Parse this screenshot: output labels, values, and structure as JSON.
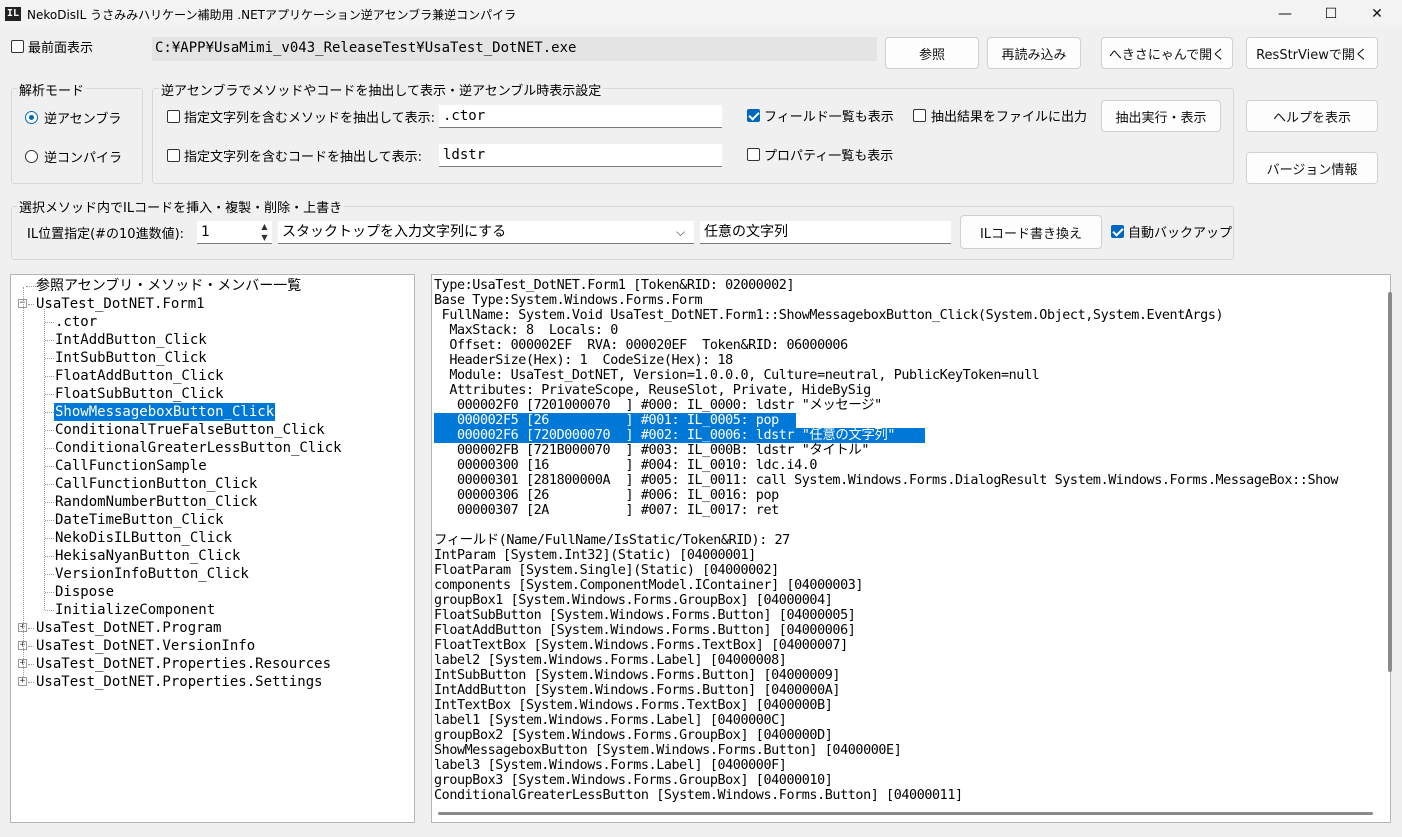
{
  "window": {
    "title": "NekoDisIL うさみみハリケーン補助用 .NETアプリケーション逆アセンブラ兼逆コンパイラ",
    "icon_text": "IL",
    "min_glyph": "—",
    "max_glyph": "☐",
    "close_glyph": "✕"
  },
  "top": {
    "topmost_label": "最前面表示",
    "file_path": "C:¥APP¥UsaMimi_v043_ReleaseTest¥UsaTest_DotNET.exe",
    "browse_label": "参照",
    "reload_label": "再読み込み",
    "open_hekisa_label": "へきさにゃんで開く",
    "open_resstr_label": "ResStrViewで開く"
  },
  "mode": {
    "title": "解析モード",
    "disasm_label": "逆アセンブラ",
    "decompile_label": "逆コンパイラ"
  },
  "extract": {
    "title": "逆アセンブラでメソッドやコードを抽出して表示・逆アセンブル時表示設定",
    "method_filter_label": "指定文字列を含むメソッドを抽出して表示:",
    "method_filter_value": ".ctor",
    "code_filter_label": "指定文字列を含むコードを抽出して表示:",
    "code_filter_value": "ldstr",
    "show_fields_label": "フィールド一覧も表示",
    "show_props_label": "プロパティ一覧も表示",
    "output_file_label": "抽出結果をファイルに出力",
    "run_label": "抽出実行・表示"
  },
  "side": {
    "help_label": "ヘルプを表示",
    "version_label": "バージョン情報"
  },
  "il": {
    "title": "選択メソッド内でILコードを挿入・複製・削除・上書き",
    "pos_label": "IL位置指定(#の10進数値):",
    "pos_value": "1",
    "op_selected": "スタックトップを入力文字列にする",
    "string_value": "任意の文字列",
    "rewrite_label": "ILコード書き換え",
    "backup_label": "自動バックアップ"
  },
  "tree": {
    "root": "参照アセンブリ・メソッド・メンバー一覧",
    "form1": "UsaTest_DotNET.Form1",
    "methods": [
      ".ctor",
      "IntAddButton_Click",
      "IntSubButton_Click",
      "FloatAddButton_Click",
      "FloatSubButton_Click",
      "ShowMessageboxButton_Click",
      "ConditionalTrueFalseButton_Click",
      "ConditionalGreaterLessButton_Click",
      "CallFunctionSample",
      "CallFunctionButton_Click",
      "RandomNumberButton_Click",
      "DateTimeButton_Click",
      "NekoDisILButton_Click",
      "HekisaNyanButton_Click",
      "VersionInfoButton_Click",
      "Dispose",
      "InitializeComponent"
    ],
    "others": [
      "UsaTest_DotNET.Program",
      "UsaTest_DotNET.VersionInfo",
      "UsaTest_DotNET.Properties.Resources",
      "UsaTest_DotNET.Properties.Settings"
    ],
    "expand_glyph": "+",
    "collapse_glyph": "−"
  },
  "output": {
    "lines": [
      "Type:UsaTest_DotNET.Form1 [Token&RID: 02000002]",
      "Base Type:System.Windows.Forms.Form",
      " FullName: System.Void UsaTest_DotNET.Form1::ShowMessageboxButton_Click(System.Object,System.EventArgs)",
      "  MaxStack: 8  Locals: 0",
      "  Offset: 000002EF  RVA: 000020EF  Token&RID: 06000006",
      "  HeaderSize(Hex): 1  CodeSize(Hex): 18",
      "  Module: UsaTest_DotNET, Version=1.0.0.0, Culture=neutral, PublicKeyToken=null",
      "  Attributes: PrivateScope, ReuseSlot, Private, HideBySig",
      "   000002F0 [7201000070  ] #000: IL_0000: ldstr \"メッセージ\"",
      "   000002F5 [26          ] #001: IL_0005: pop",
      "   000002F6 [720D000070  ] #002: IL_0006: ldstr \"任意の文字列\"",
      "   000002FB [721B000070  ] #003: IL_000B: ldstr \"タイトル\"",
      "   00000300 [16          ] #004: IL_0010: ldc.i4.0",
      "   00000301 [281800000A  ] #005: IL_0011: call System.Windows.Forms.DialogResult System.Windows.Forms.MessageBox::Show",
      "   00000306 [26          ] #006: IL_0016: pop",
      "   00000307 [2A          ] #007: IL_0017: ret",
      "",
      "フィールド(Name/FullName/IsStatic/Token&RID): 27",
      "IntParam [System.Int32](Static) [04000001]",
      "FloatParam [System.Single](Static) [04000002]",
      "components [System.ComponentModel.IContainer] [04000003]",
      "groupBox1 [System.Windows.Forms.GroupBox] [04000004]",
      "FloatSubButton [System.Windows.Forms.Button] [04000005]",
      "FloatAddButton [System.Windows.Forms.Button] [04000006]",
      "FloatTextBox [System.Windows.Forms.TextBox] [04000007]",
      "label2 [System.Windows.Forms.Label] [04000008]",
      "IntSubButton [System.Windows.Forms.Button] [04000009]",
      "IntAddButton [System.Windows.Forms.Button] [0400000A]",
      "IntTextBox [System.Windows.Forms.TextBox] [0400000B]",
      "label1 [System.Windows.Forms.Label] [0400000C]",
      "groupBox2 [System.Windows.Forms.GroupBox] [0400000D]",
      "ShowMessageboxButton [System.Windows.Forms.Button] [0400000E]",
      "label3 [System.Windows.Forms.Label] [0400000F]",
      "groupBox3 [System.Windows.Forms.GroupBox] [04000010]",
      "ConditionalGreaterLessButton [System.Windows.Forms.Button] [04000011]"
    ]
  }
}
